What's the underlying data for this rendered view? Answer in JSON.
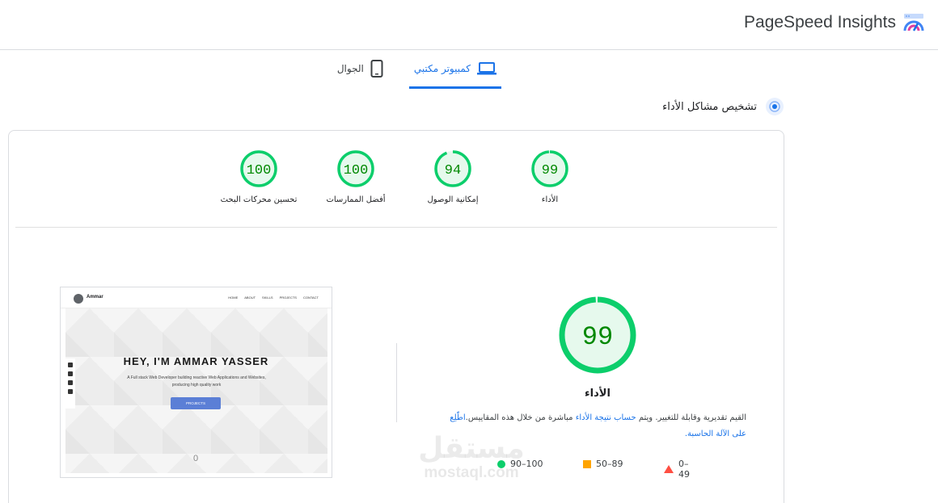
{
  "header": {
    "title": "PageSpeed Insights",
    "logo_icon": "pagespeed-logo-icon"
  },
  "tabs": [
    {
      "label": "كمبيوتر مكتبي",
      "icon": "laptop-icon",
      "active": true
    },
    {
      "label": "الجوال",
      "icon": "phone-icon",
      "active": false
    }
  ],
  "diagnose": {
    "label": "تشخيص مشاكل الأداء",
    "icon": "lighthouse-icon"
  },
  "scores": [
    {
      "label": "الأداء",
      "value": "99",
      "fraction": 0.99
    },
    {
      "label": "إمكانية الوصول",
      "value": "94",
      "fraction": 0.94
    },
    {
      "label": "أفضل الممارسات",
      "value": "100",
      "fraction": 1.0
    },
    {
      "label": "تحسين محركات البحث",
      "value": "100",
      "fraction": 1.0
    }
  ],
  "performance": {
    "value": "99",
    "fraction": 0.99,
    "label": "الأداء",
    "desc_prefix": "القيم تقديرية وقابلة للتغيير. ويتم ",
    "desc_link1": "حساب نتيجة الأداء",
    "desc_middle": " مباشرة من خلال هذه المقاييس.",
    "desc_link2": "اطّلِع على الآلة الحاسبة."
  },
  "legend": [
    {
      "range": "0–49",
      "shape": "triangle"
    },
    {
      "range": "50–89",
      "shape": "square"
    },
    {
      "range": "90–100",
      "shape": "circle"
    }
  ],
  "colors": {
    "good": "#0cce6b",
    "good_text": "#008800",
    "good_bg": "#e6f9ed",
    "average": "#ffa400",
    "poor": "#ff4e42",
    "accent": "#1a73e8"
  },
  "preview": {
    "site_name": "Ammar",
    "nav_links": [
      "HOME",
      "ABOUT",
      "SKILLS",
      "PROJECTS",
      "CONTACT"
    ],
    "hero_title": "HEY, I'M AMMAR YASSER",
    "hero_subtitle": "A Full stack Web Developer building reactive Web Applications and Websites, producing high quality work",
    "button_label": "PROJECTS",
    "scroll_indicator": "0"
  },
  "watermark": {
    "arabic": "مستقل",
    "latin": "mostaql.com"
  }
}
